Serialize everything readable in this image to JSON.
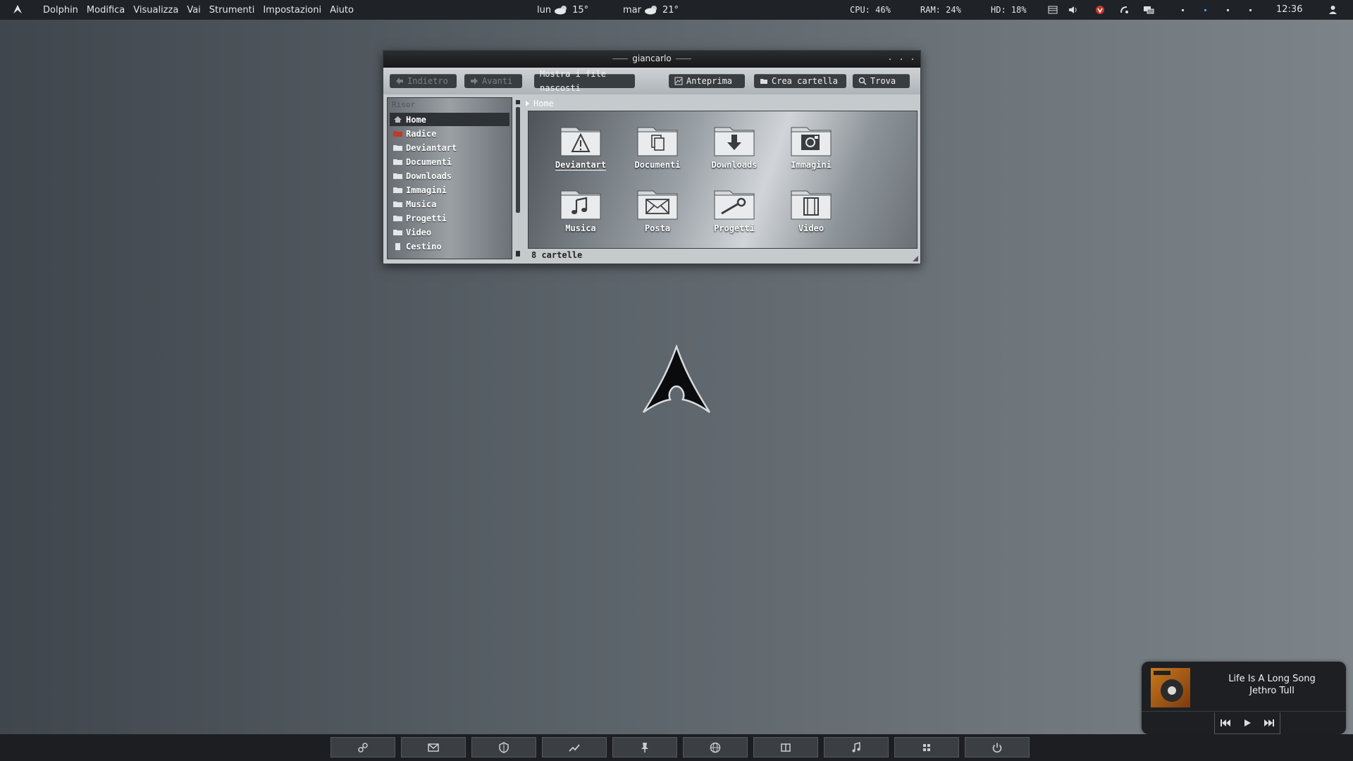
{
  "top_panel": {
    "menu": [
      "Dolphin",
      "Modifica",
      "Visualizza",
      "Vai",
      "Strumenti",
      "Impostazioni",
      "Aiuto"
    ],
    "weather": [
      {
        "day": "lun",
        "temp": "15°",
        "icon": "cloud-sun-icon"
      },
      {
        "day": "mar",
        "temp": "21°",
        "icon": "cloud-sun-icon"
      }
    ],
    "cpu": "CPU: 46%",
    "ram": "RAM: 24%",
    "hd": "HD: 18%",
    "clock": "12:36"
  },
  "window": {
    "title": "giancarlo",
    "toolbar": {
      "back": "Indietro",
      "forward": "Avanti",
      "show_hidden": "Mostra i file nascosti",
      "preview": "Anteprima",
      "new_folder": "Crea cartella",
      "find": "Trova"
    },
    "sidebar": {
      "header": "Risor",
      "items": [
        {
          "label": "Home",
          "icon": "home-icon"
        },
        {
          "label": "Radice",
          "icon": "red-folder-icon"
        },
        {
          "label": "Deviantart",
          "icon": "folder-icon"
        },
        {
          "label": "Documenti",
          "icon": "folder-icon"
        },
        {
          "label": "Downloads",
          "icon": "folder-icon"
        },
        {
          "label": "Immagini",
          "icon": "folder-icon"
        },
        {
          "label": "Musica",
          "icon": "folder-icon"
        },
        {
          "label": "Progetti",
          "icon": "folder-icon"
        },
        {
          "label": "Video",
          "icon": "folder-icon"
        },
        {
          "label": "Cestino",
          "icon": "trash-icon"
        }
      ],
      "selected": "Home"
    },
    "breadcrumb": "Home",
    "folders": [
      {
        "label": "Deviantart",
        "icon": "warning-folder-icon"
      },
      {
        "label": "Documenti",
        "icon": "documents-folder-icon"
      },
      {
        "label": "Downloads",
        "icon": "download-folder-icon"
      },
      {
        "label": "Immagini",
        "icon": "images-folder-icon"
      },
      {
        "label": "Musica",
        "icon": "music-folder-icon"
      },
      {
        "label": "Posta",
        "icon": "mail-folder-icon"
      },
      {
        "label": "Progetti",
        "icon": "wrench-folder-icon"
      },
      {
        "label": "Video",
        "icon": "film-folder-icon"
      }
    ],
    "status": "8 cartelle"
  },
  "player": {
    "title": "Life Is A Long Song",
    "artist": "Jethro Tull"
  },
  "dock": {
    "icons": [
      "link-icon",
      "mail-icon",
      "shield-icon",
      "chart-icon",
      "pin-icon",
      "globe-icon",
      "book-icon",
      "music-icon",
      "apps-icon",
      "power-icon"
    ]
  },
  "colors": {
    "accent": "#3fa3ff",
    "panel": "#1f2226",
    "red": "#c0392b"
  }
}
